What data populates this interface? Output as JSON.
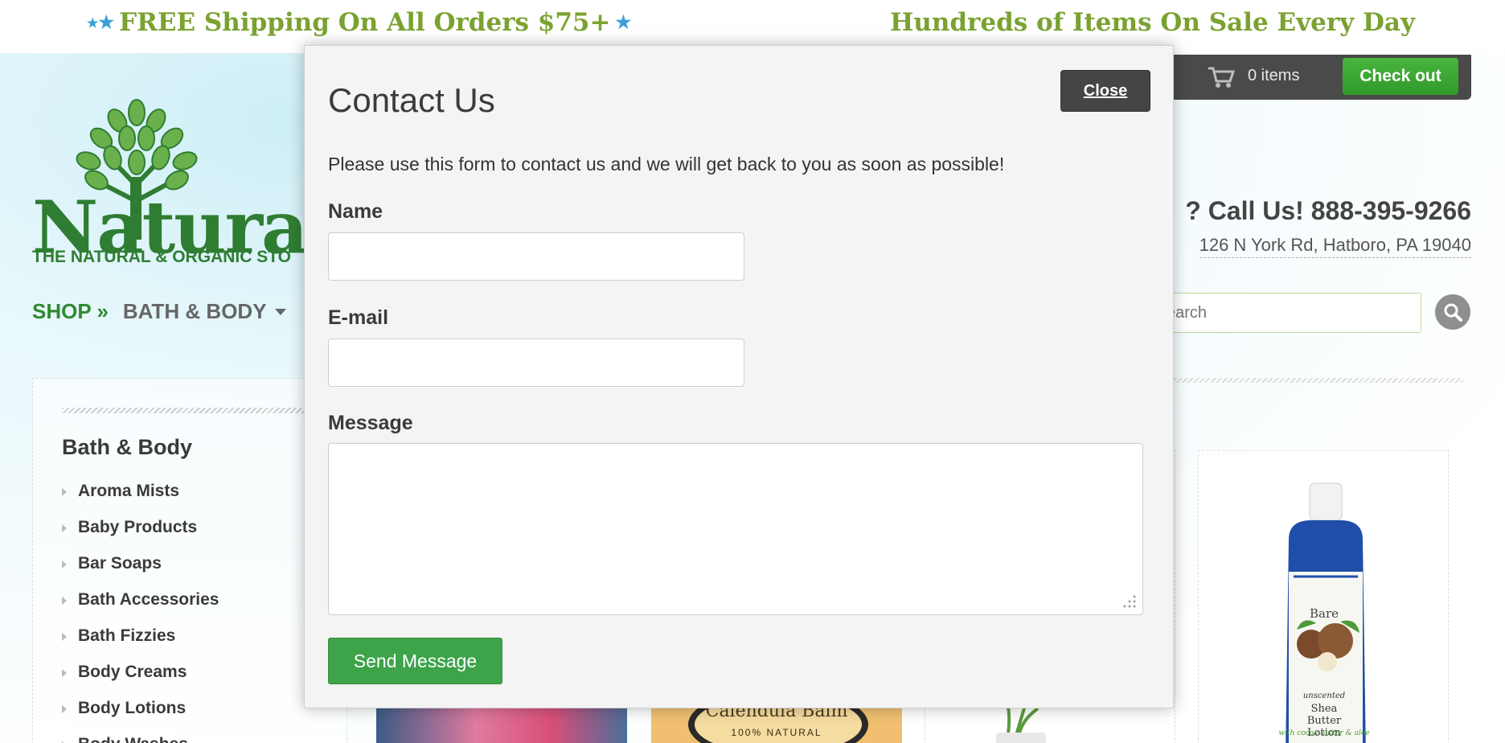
{
  "promo": {
    "left_text": "FREE Shipping On All Orders $75+",
    "right_text": "Hundreds of Items On Sale Every Day"
  },
  "logo": {
    "wordmark": "Naturalisti",
    "tagline": "THE NATURAL & ORGANIC STO"
  },
  "nav": {
    "shop_label": "SHOP »",
    "category_label": "BATH & BODY"
  },
  "cart": {
    "count_label": "0 items",
    "checkout_label": "Check out"
  },
  "contact": {
    "phone_line": "? Call Us! 888-395-9266",
    "address": "126 N York Rd, Hatboro, PA 19040"
  },
  "search": {
    "placeholder": "earch"
  },
  "sidebar": {
    "title": "Bath & Body",
    "items": [
      {
        "label": "Aroma Mists"
      },
      {
        "label": "Baby Products"
      },
      {
        "label": "Bar Soaps"
      },
      {
        "label": "Bath Accessories"
      },
      {
        "label": "Bath Fizzies"
      },
      {
        "label": "Body Creams"
      },
      {
        "label": "Body Lotions"
      },
      {
        "label": "Body Washes"
      }
    ]
  },
  "products": {
    "calendula_title": "Calendula Balm",
    "calendula_sub": "100% NATURAL",
    "lotion_brand": "Bare",
    "lotion_kind": "unscented",
    "lotion_name": "Shea Butter Lotion",
    "lotion_note": "with cocoa butter & aloe"
  },
  "modal": {
    "title": "Contact Us",
    "close_label": "Close",
    "description": "Please use this form to contact us and we will get back to you as soon as possible!",
    "name_label": "Name",
    "name_value": "",
    "email_label": "E-mail",
    "email_value": "",
    "message_label": "Message",
    "message_value": "",
    "send_label": "Send Message"
  },
  "colors": {
    "promo_green": "#7aa230",
    "brand_green": "#2f7d32",
    "checkout_green": "#3da44a",
    "star_blue": "#3a9fd8",
    "dark_button": "#454545"
  }
}
